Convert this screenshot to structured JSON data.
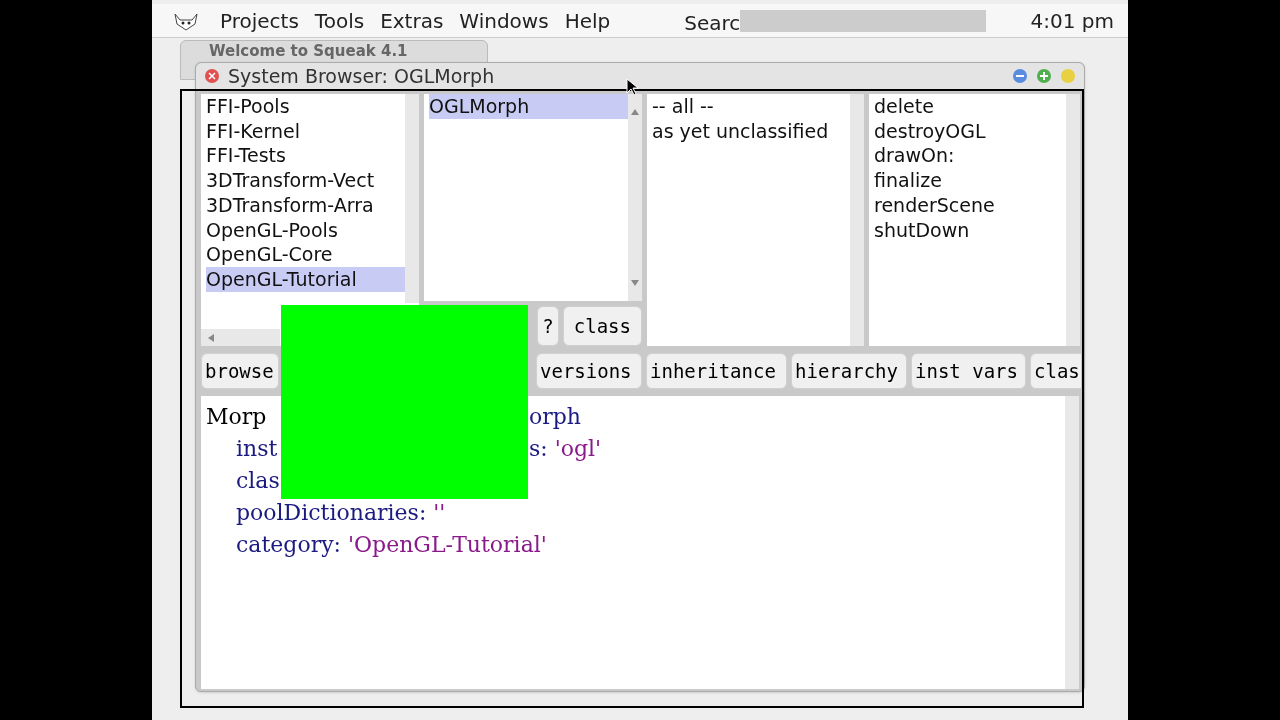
{
  "menu_bar": {
    "items": [
      "Projects",
      "Tools",
      "Extras",
      "Windows",
      "Help"
    ],
    "search_label": "Searc",
    "clock": "4:01 pm"
  },
  "background_window": {
    "title": "Welcome to Squeak 4.1"
  },
  "window": {
    "title": "System Browser: OGLMorph"
  },
  "package_list": [
    {
      "label": "FFI-Pools",
      "selected": false
    },
    {
      "label": "FFI-Kernel",
      "selected": false
    },
    {
      "label": "FFI-Tests",
      "selected": false
    },
    {
      "label": "3DTransform-Vect",
      "selected": false
    },
    {
      "label": "3DTransform-Arra",
      "selected": false
    },
    {
      "label": "OpenGL-Pools",
      "selected": false
    },
    {
      "label": "OpenGL-Core",
      "selected": false
    },
    {
      "label": "OpenGL-Tutorial",
      "selected": true
    }
  ],
  "class_list": [
    {
      "label": "OGLMorph",
      "selected": true
    }
  ],
  "class_buttons": [
    "?",
    "class"
  ],
  "protocol_list": [
    {
      "label": "-- all --",
      "selected": false
    },
    {
      "label": "as yet unclassified",
      "selected": false
    }
  ],
  "method_list": [
    {
      "label": "delete",
      "selected": false
    },
    {
      "label": "destroyOGL",
      "selected": false
    },
    {
      "label": "drawOn:",
      "selected": false
    },
    {
      "label": "finalize",
      "selected": false
    },
    {
      "label": "renderScene",
      "selected": false
    },
    {
      "label": "shutDown",
      "selected": false
    }
  ],
  "tool_buttons": [
    "browse",
    "versions",
    "inheritance",
    "hierarchy",
    "inst vars",
    "clas"
  ],
  "code": [
    {
      "kind": "head",
      "left": [
        {
          "text": "Morp",
          "kind": "plain"
        }
      ],
      "right": [
        {
          "text": "orph",
          "kind": "keyword"
        }
      ]
    },
    {
      "kind": "arg",
      "left": [
        {
          "text": "inst",
          "kind": "keyword"
        }
      ],
      "right": [
        {
          "text": "s: ",
          "kind": "keyword"
        },
        {
          "text": "'ogl'",
          "kind": "string"
        }
      ]
    },
    {
      "kind": "arg",
      "left": [
        {
          "text": "clas",
          "kind": "keyword"
        }
      ]
    },
    {
      "kind": "arg",
      "left": [
        {
          "text": "poolDictionaries: ",
          "kind": "keyword"
        },
        {
          "text": "''",
          "kind": "string"
        }
      ]
    },
    {
      "kind": "arg",
      "left": [
        {
          "text": "category: ",
          "kind": "keyword"
        },
        {
          "text": "'OpenGL-Tutorial'",
          "kind": "string"
        }
      ]
    }
  ]
}
